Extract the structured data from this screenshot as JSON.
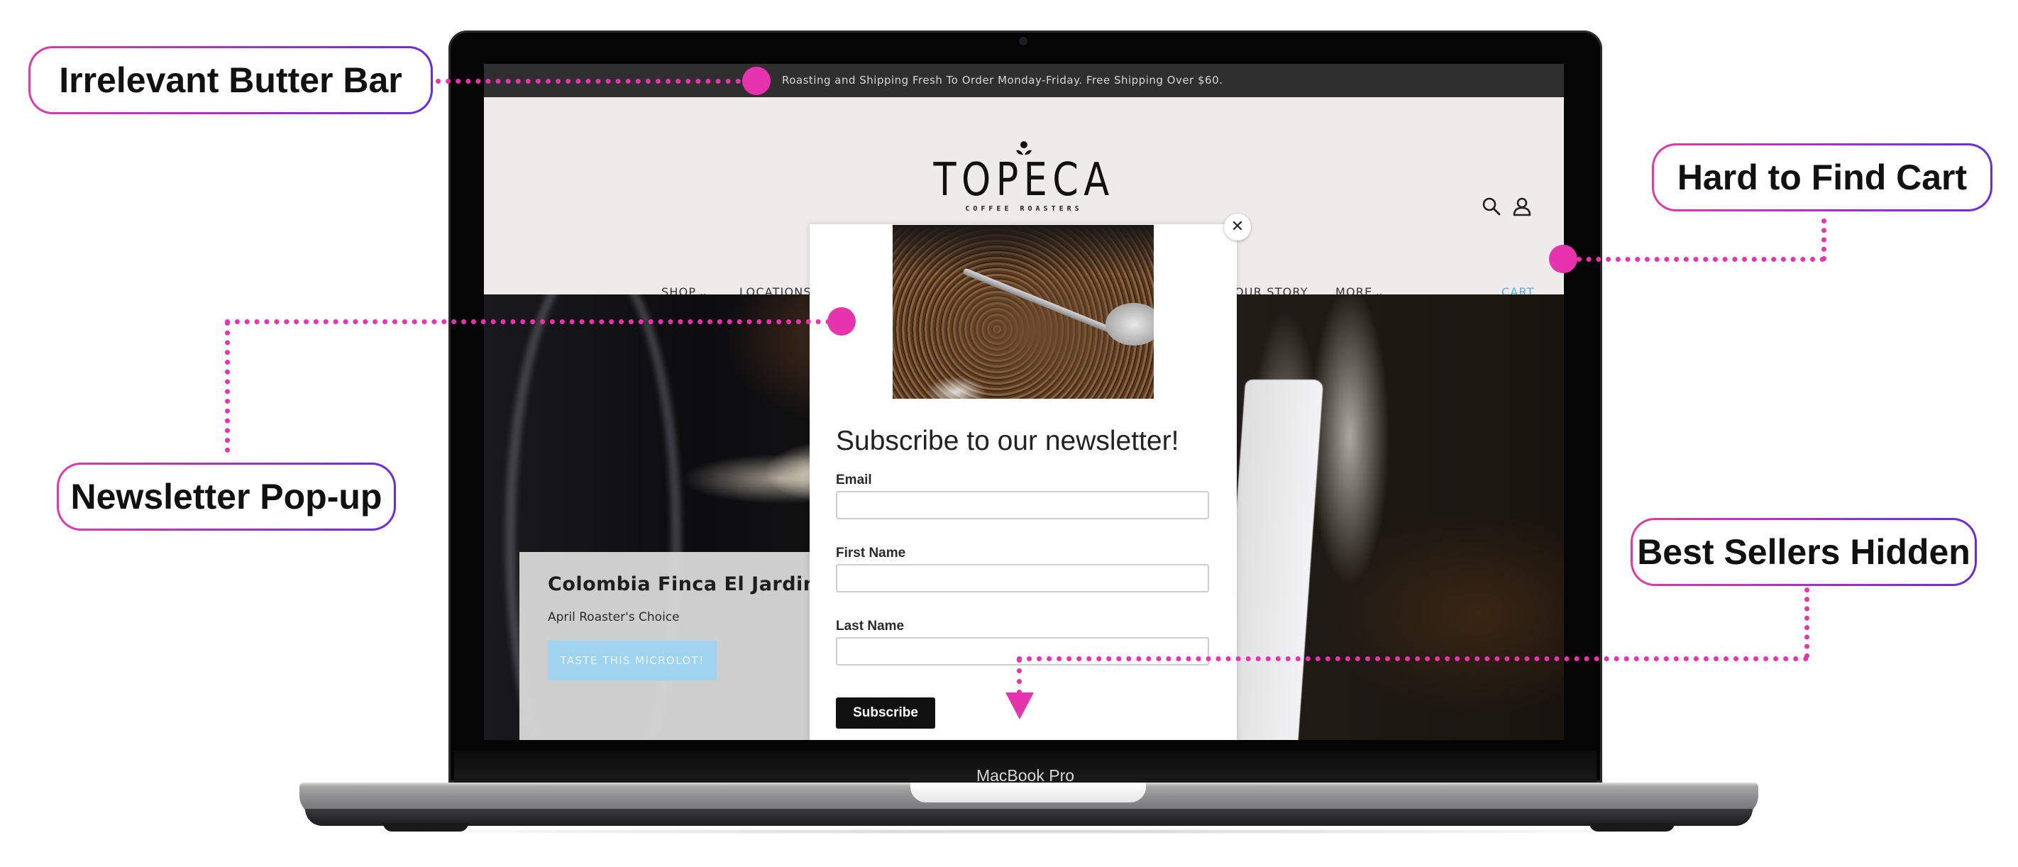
{
  "device": {
    "label": "MacBook Pro"
  },
  "site": {
    "butter_bar": {
      "text": "Roasting and Shipping Fresh To Order Monday-Friday. Free Shipping Over $60."
    },
    "logo": {
      "name": "TOPECA",
      "tagline": "COFFEE ROASTERS",
      "icon": "coffee-sprout-icon"
    },
    "header_icons": [
      {
        "name": "search-icon",
        "label": "Search"
      },
      {
        "name": "account-icon",
        "label": "Account"
      }
    ],
    "nav": {
      "items": [
        {
          "label": "SHOP",
          "dropdown": true
        },
        {
          "label": "LOCATIONS",
          "dropdown": false
        },
        {
          "label": "OUR STORY",
          "dropdown": false
        },
        {
          "label": "MORE",
          "dropdown": true
        }
      ],
      "chevron": "⌄",
      "cart_label": "CART",
      "cart_color": "#5aaee0"
    },
    "hero": {
      "title": "Colombia Finca El Jardin",
      "subtitle": "April Roaster's Choice",
      "cta_label": "TASTE THIS MICROLOT!",
      "cta_color": "#9fd3ee"
    },
    "popup": {
      "close_label": "✕",
      "title": "Subscribe to our newsletter!",
      "fields": [
        {
          "label": "Email",
          "value": "",
          "placeholder": ""
        },
        {
          "label": "First Name",
          "value": "",
          "placeholder": ""
        },
        {
          "label": "Last Name",
          "value": "",
          "placeholder": ""
        }
      ],
      "submit_label": "Subscribe"
    }
  },
  "annotations": {
    "accent_color": "#e733ad",
    "gradient": [
      "#e13aa7",
      "#6a2be0"
    ],
    "callouts": [
      {
        "id": "butter-bar",
        "label": "Irrelevant Butter Bar"
      },
      {
        "id": "cart",
        "label": "Hard to Find Cart"
      },
      {
        "id": "newsletter",
        "label": "Newsletter Pop-up"
      },
      {
        "id": "best-sellers",
        "label": "Best Sellers Hidden"
      }
    ]
  }
}
